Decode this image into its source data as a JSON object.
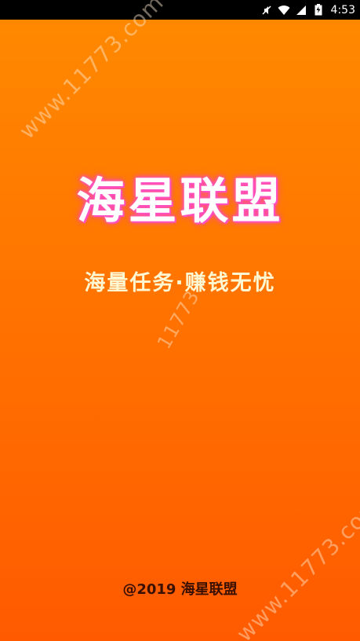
{
  "status_bar": {
    "time": "4:53",
    "icons": [
      "mute-icon",
      "wifi-icon",
      "signal-icon",
      "battery-icon"
    ]
  },
  "splash": {
    "title": "海星联盟",
    "slogan": "海量任务·赚钱无忧",
    "copyright": "@2019 海星联盟"
  },
  "watermarks": {
    "top": "www.11773.com",
    "middle": "11773",
    "bottom": "www.11773.com"
  },
  "colors": {
    "background_top": "#ff8a00",
    "background_bottom": "#ff5a00",
    "title_glow": "#ff44bb",
    "slogan": "#fff6d2",
    "copyright": "#3a1000"
  }
}
